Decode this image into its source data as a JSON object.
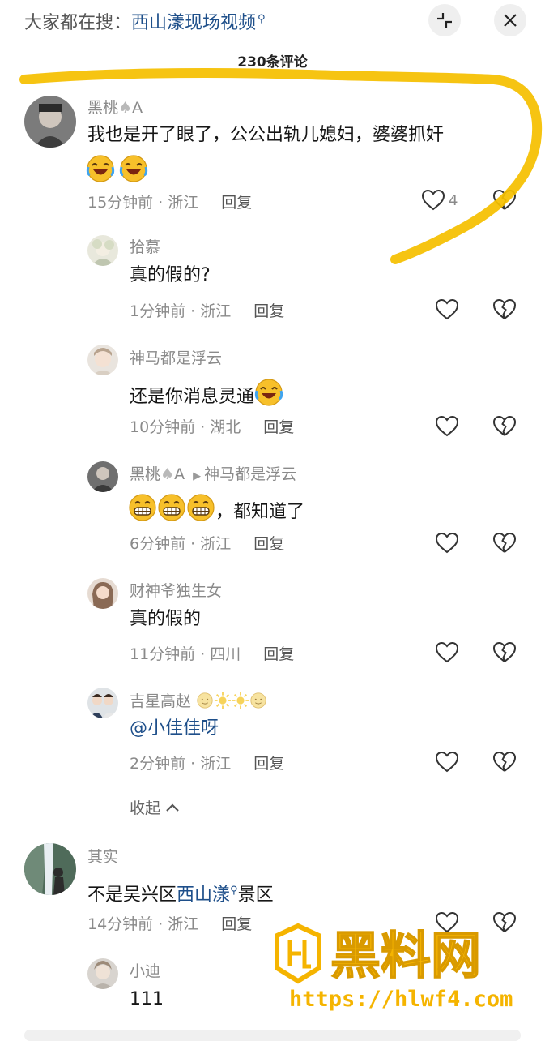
{
  "header": {
    "search_prefix": "大家都在搜：",
    "search_keyword": "西山漾现场视频",
    "comment_count": "230条评论"
  },
  "comments": [
    {
      "user": "黑桃",
      "suit": "♠",
      "user_suffix": "A",
      "text": "我也是开了眼了，公公出轨儿媳妇，婆婆抓奸",
      "time": "15分钟前 · 浙江",
      "reply": "回复",
      "likes": "4"
    },
    {
      "user": "拾慕",
      "text": "真的假的?",
      "time": "1分钟前 · 浙江",
      "reply": "回复"
    },
    {
      "user": "神马都是浮云",
      "text": "还是你消息灵通",
      "time": "10分钟前 · 湖北",
      "reply": "回复"
    },
    {
      "user": "黑桃",
      "suit": "♠",
      "user_suffix": "A",
      "reply_to": "神马都是浮云",
      "text": "，都知道了",
      "time": "6分钟前 · 浙江",
      "reply": "回复"
    },
    {
      "user": "财神爷独生女",
      "text": "真的假的",
      "time": "11分钟前 · 四川",
      "reply": "回复"
    },
    {
      "user": "吉星高赵",
      "text": "@小佳佳呀",
      "time": "2分钟前 · 浙江",
      "reply": "回复"
    },
    {
      "user": "其实",
      "text_before": "不是吴兴区",
      "text_link": "西山漾",
      "text_after": "景区",
      "time": "14分钟前 · 浙江",
      "reply": "回复"
    },
    {
      "user": "小迪",
      "text": "111"
    }
  ],
  "collapse_label": "收起",
  "watermark": {
    "brand": "黑料网",
    "url": "https://hlwf4.com"
  },
  "colors": {
    "accent_link": "#1e4f8a",
    "highlight": "#f5b400"
  },
  "icons": [
    "collapse-icon",
    "close-icon",
    "heart-icon",
    "broken-heart-icon",
    "search-hint-icon",
    "chevron-up-icon"
  ]
}
